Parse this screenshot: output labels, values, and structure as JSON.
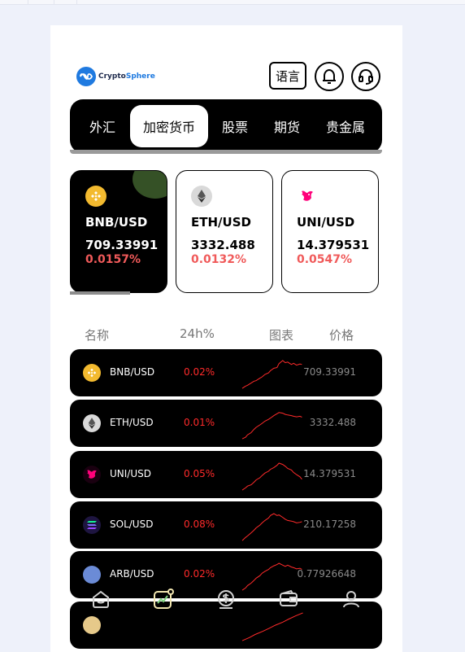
{
  "header": {
    "logo_prefix": "Crypto",
    "logo_suffix": "Sphere",
    "lang_button": "语言"
  },
  "tabs": [
    {
      "label": "外汇",
      "active": false
    },
    {
      "label": "加密货币",
      "active": true
    },
    {
      "label": "股票",
      "active": false
    },
    {
      "label": "期货",
      "active": false
    },
    {
      "label": "贵金属",
      "active": false
    }
  ],
  "cards": [
    {
      "pair": "BNB/USD",
      "price": "709.33991",
      "change": "0.0157%",
      "icon": "bnb-icon",
      "color": "#f3ba2f"
    },
    {
      "pair": "ETH/USD",
      "price": "3332.488",
      "change": "0.0132%",
      "icon": "eth-icon",
      "color": "#627eea"
    },
    {
      "pair": "UNI/USD",
      "price": "14.379531",
      "change": "0.0547%",
      "icon": "uni-icon",
      "color": "#ff007a"
    }
  ],
  "table": {
    "headers": {
      "name": "名称",
      "change": "24h%",
      "chart": "图表",
      "price": "价格"
    },
    "rows": [
      {
        "pair": "BNB/USD",
        "change": "0.02%",
        "price": "709.33991",
        "icon": "bnb-icon",
        "color": "#f3ba2f",
        "spark": [
          0.05,
          0.12,
          0.15,
          0.22,
          0.28,
          0.3,
          0.38,
          0.42,
          0.5,
          0.55,
          0.62,
          0.7,
          0.72,
          0.85,
          0.95,
          0.88,
          0.9,
          0.82,
          0.86,
          0.8,
          0.84,
          0.82
        ]
      },
      {
        "pair": "ETH/USD",
        "change": "0.01%",
        "price": "3332.488",
        "icon": "eth-icon",
        "color": "#627eea",
        "spark": [
          0.05,
          0.1,
          0.18,
          0.25,
          0.35,
          0.42,
          0.5,
          0.55,
          0.62,
          0.68,
          0.72,
          0.8,
          0.86,
          0.9,
          0.88,
          0.84,
          0.82,
          0.8,
          0.78,
          0.76,
          0.78,
          0.75
        ]
      },
      {
        "pair": "UNI/USD",
        "change": "0.05%",
        "price": "14.379531",
        "icon": "uni-icon",
        "color": "#ff007a",
        "spark": [
          0.05,
          0.12,
          0.18,
          0.22,
          0.3,
          0.38,
          0.45,
          0.52,
          0.6,
          0.66,
          0.72,
          0.78,
          0.85,
          0.92,
          0.88,
          0.82,
          0.75,
          0.7,
          0.62,
          0.55,
          0.48,
          0.4
        ]
      },
      {
        "pair": "SOL/USD",
        "change": "0.08%",
        "price": "210.17258",
        "icon": "sol-icon",
        "color": "#9945ff",
        "spark": [
          0.05,
          0.15,
          0.2,
          0.3,
          0.38,
          0.46,
          0.55,
          0.62,
          0.7,
          0.78,
          0.86,
          0.92,
          0.86,
          0.88,
          0.8,
          0.74,
          0.7,
          0.68,
          0.66,
          0.62,
          0.64,
          0.66
        ]
      },
      {
        "pair": "ARB/USD",
        "change": "0.02%",
        "price": "0.77926648",
        "icon": "arb-icon",
        "color": "#6b8bd6",
        "spark": [
          0.05,
          0.12,
          0.2,
          0.28,
          0.36,
          0.44,
          0.52,
          0.6,
          0.66,
          0.72,
          0.78,
          0.84,
          0.88,
          0.92,
          0.86,
          0.82,
          0.86,
          0.8,
          0.78,
          0.74,
          0.76,
          0.72
        ]
      },
      {
        "pair": "",
        "change": "",
        "price": "",
        "icon": "coin-icon",
        "color": "#e6c98a",
        "spark": [
          0.05,
          0.15,
          0.25,
          0.35,
          0.45,
          0.55,
          0.65,
          0.75,
          0.85,
          0.95
        ]
      }
    ]
  },
  "bottom_nav": [
    {
      "label": "home",
      "icon": "home-icon"
    },
    {
      "label": "market",
      "icon": "chart-icon"
    },
    {
      "label": "trade",
      "icon": "dollar-icon"
    },
    {
      "label": "wallet",
      "icon": "wallet-icon"
    },
    {
      "label": "profile",
      "icon": "user-icon"
    }
  ],
  "colors": {
    "accent_red": "#ff2a2a",
    "card_change": "#f05a5a",
    "brand": "#1f7ae0"
  }
}
